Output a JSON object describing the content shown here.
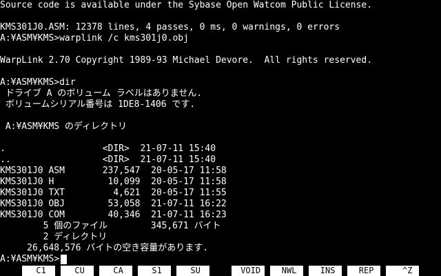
{
  "colors": {
    "background": "#000000",
    "foreground": "#ffffff",
    "fkey_background": "#ffffff",
    "fkey_text": "#000000"
  },
  "terminal": {
    "lines": [
      "Source code is available under the Sybase Open Watcom Public License.",
      "",
      "KMS301J0.ASM: 12378 lines, 4 passes, 0 ms, 0 warnings, 0 errors",
      "A:¥ASM¥KMS>warplink /c kms301j0.obj",
      "",
      "WarpLink 2.70 Copyright 1989-93 Michael Devore.  All rights reserved.",
      "",
      "A:¥ASM¥KMS>dir",
      " ドライブ A のボリューム ラベルはありません.",
      " ボリュームシリアル番号は 1DE8-1406 です.",
      "",
      " A:¥ASM¥KMS のディレクトリ",
      "",
      ".                  <DIR>  21-07-11 15:40",
      "..                 <DIR>  21-07-11 15:40",
      "KMS301J0 ASM       237,547  20-05-17 11:58",
      "KMS301J0 H          10,099  20-05-17 11:58",
      "KMS301J0 TXT         4,621  20-05-17 11:55",
      "KMS301J0 OBJ        53,058  21-07-11 16:22",
      "KMS301J0 COM        40,346  21-07-11 16:23",
      "        5 個のファイル        345,671 バイト",
      "        2 ディレクトリ",
      "     26,648,576 バイトの空き容量があります.",
      "A:¥ASM¥KMS>"
    ]
  },
  "function_keys": [
    {
      "label": " C1"
    },
    {
      "label": " CU"
    },
    {
      "label": " CA"
    },
    {
      "label": " S1"
    },
    {
      "label": " SU"
    },
    {
      "label": " VOID"
    },
    {
      "label": " NWL"
    },
    {
      "label": " INS"
    },
    {
      "label": " REP"
    },
    {
      "label": "  ^Z"
    }
  ]
}
